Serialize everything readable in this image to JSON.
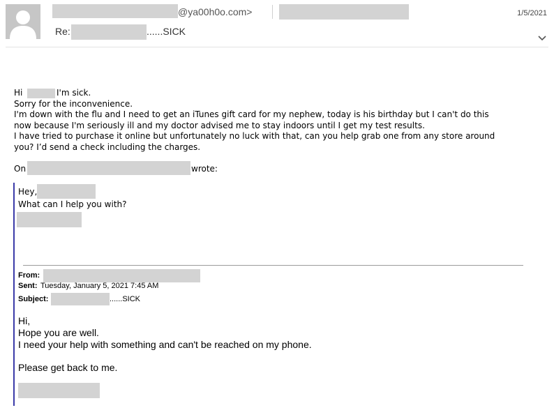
{
  "header": {
    "sender_domain": "@ya00h0o.com>",
    "date": "1/5/2021",
    "subject_prefix": "Re:",
    "subject_suffix": "......SICK"
  },
  "message": {
    "greeting": "Hi",
    "greeting_tail": "I'm sick.",
    "lines": [
      "Sorry for the inconvenience.",
      "I'm down with the flu and I need to get an iTunes gift card for my nephew, today is his birthday but I can't do this",
      "now because I'm seriously ill and my doctor advised me to stay indoors until I get my test results.",
      "I have tried to purchase it online but unfortunately no luck with that, can you help grab one from any store around",
      "you? I’d send a check including the charges."
    ],
    "on_prefix": "On",
    "wrote_suffix": "wrote:"
  },
  "reply": {
    "hey": "Hey,",
    "question": "What can I help you with?"
  },
  "forwarded": {
    "from_label": "From:",
    "sent_label": "Sent:",
    "sent_value": "Tuesday, January 5, 2021 7:45 AM",
    "subject_label": "Subject:",
    "subject_suffix": "......SICK"
  },
  "original": {
    "hi": "Hi,",
    "line1": "Hope you are well.",
    "line2": "I need your help with something and can't be reached on my phone.",
    "line3": "Please get back to me."
  },
  "colors": {
    "redaction": "#d3d3d3",
    "quote_bar": "#3a3aa8"
  },
  "icons": {
    "avatar": "person-silhouette-icon",
    "expand": "chevron-down-icon"
  }
}
